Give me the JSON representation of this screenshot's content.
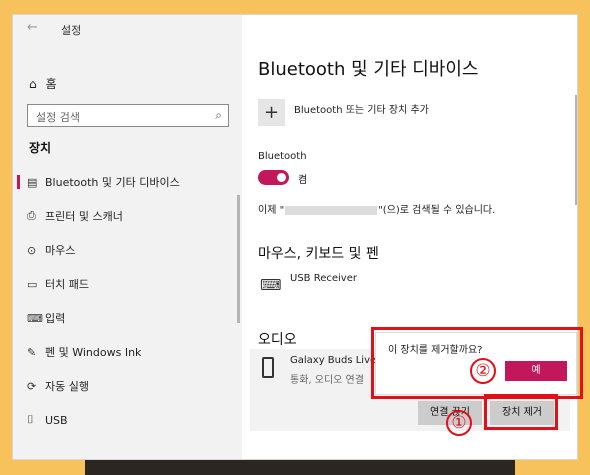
{
  "window": {
    "back_glyph": "←",
    "title": "설정",
    "minimize_glyph": "—",
    "maximize_glyph": "☐",
    "close_glyph": "✕"
  },
  "sidebar": {
    "home_label": "홈",
    "search_placeholder": "설정 검색",
    "section_title": "장치",
    "items": [
      {
        "label": "Bluetooth 및 기타 디바이스",
        "icon": "bluetooth-devices-icon",
        "glyph": "▤",
        "active": true
      },
      {
        "label": "프린터 및 스캐너",
        "icon": "printer-icon",
        "glyph": "⎙"
      },
      {
        "label": "마우스",
        "icon": "mouse-icon",
        "glyph": "⊙"
      },
      {
        "label": "터치 패드",
        "icon": "touchpad-icon",
        "glyph": "▭"
      },
      {
        "label": "입력",
        "icon": "keyboard-icon",
        "glyph": "⌨"
      },
      {
        "label": "펜 및 Windows Ink",
        "icon": "pen-icon",
        "glyph": "✎"
      },
      {
        "label": "자동 실행",
        "icon": "autoplay-icon",
        "glyph": "⟳"
      },
      {
        "label": "USB",
        "icon": "usb-icon",
        "glyph": "⌷"
      }
    ]
  },
  "main": {
    "title": "Bluetooth 및 기타 디바이스",
    "add_button_glyph": "+",
    "add_label": "Bluetooth 또는 기타 장치 추가",
    "bluetooth_label": "Bluetooth",
    "toggle_state": "켬",
    "discoverable_prefix": "이제 \"",
    "discoverable_suffix": "\"(으)로 검색될 수 있습니다.",
    "input_section": "마우스, 키보드 및 펜",
    "usb_receiver": "USB Receiver",
    "audio_section": "오디오",
    "device_name": "Galaxy Buds Live",
    "device_status": "통화, 오디오 연결",
    "disconnect_button": "연결 끊기",
    "remove_button": "장치 제거"
  },
  "popup": {
    "question": "이 장치를 제거할까요?",
    "yes_button": "예"
  },
  "annotations": {
    "step1": "①",
    "step2": "②"
  },
  "colors": {
    "accent": "#c2185b",
    "annotation": "#e0101a"
  }
}
